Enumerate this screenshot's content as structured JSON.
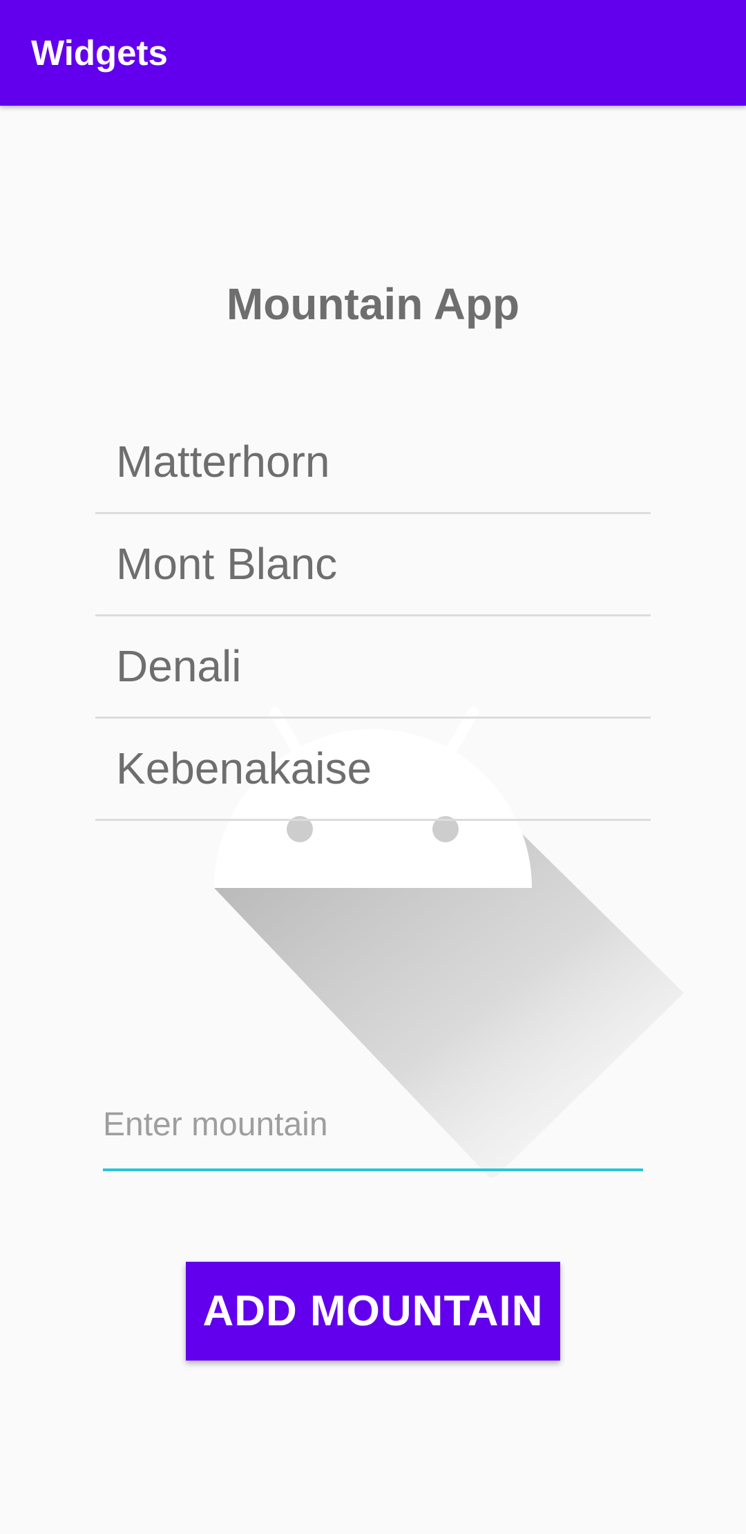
{
  "app_bar": {
    "title": "Widgets",
    "color": "#6200EE"
  },
  "main": {
    "heading": "Mountain App",
    "mountains": [
      "Matterhorn",
      "Mont Blanc",
      "Denali",
      "Kebenakaise"
    ],
    "input": {
      "value": "",
      "placeholder": "Enter mountain",
      "underline_color": "#26C6DA"
    },
    "add_button_label": "ADD MOUNTAIN"
  },
  "background": {
    "icon": "android-icon"
  }
}
